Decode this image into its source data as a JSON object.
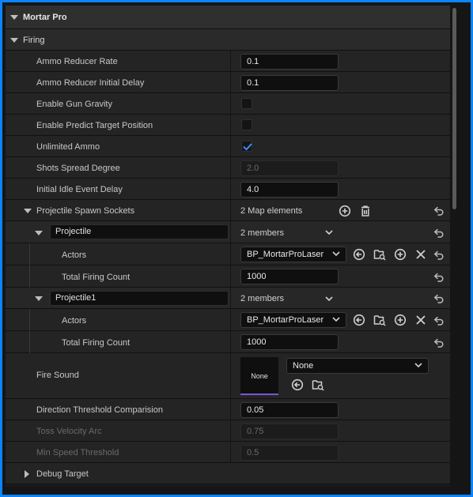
{
  "header": {
    "title": "Mortar Pro"
  },
  "firing": {
    "title": "Firing",
    "ammo_reducer_rate": {
      "label": "Ammo Reducer Rate",
      "value": "0.1"
    },
    "ammo_reducer_initial_delay": {
      "label": "Ammo Reducer Initial Delay",
      "value": "0.1"
    },
    "enable_gun_gravity": {
      "label": "Enable Gun Gravity",
      "checked": false
    },
    "enable_predict_target_position": {
      "label": "Enable Predict Target Position",
      "checked": false
    },
    "unlimited_ammo": {
      "label": "Unlimited Ammo",
      "checked": true
    },
    "shots_spread_degree": {
      "label": "Shots Spread Degree",
      "value": "2.0"
    },
    "initial_idle_event_delay": {
      "label": "Initial Idle Event Delay",
      "value": "4.0"
    },
    "projectile_spawn_sockets": {
      "label": "Projectile Spawn Sockets",
      "summary": "2 Map elements",
      "elements": [
        {
          "name": "Projectile",
          "summary": "2 members",
          "actors_label": "Actors",
          "actors_value": "BP_MortarProLaser",
          "count_label": "Total Firing Count",
          "count_value": "1000"
        },
        {
          "name": "Projectile1",
          "summary": "2 members",
          "actors_label": "Actors",
          "actors_value": "BP_MortarProLaser",
          "count_label": "Total Firing Count",
          "count_value": "1000"
        }
      ]
    },
    "fire_sound": {
      "label": "Fire Sound",
      "thumb": "None",
      "value": "None"
    },
    "direction_threshold_comparision": {
      "label": "Direction Threshold Comparision",
      "value": "0.05"
    },
    "toss_velocity_arc": {
      "label": "Toss Velocity Arc",
      "value": "0.75"
    },
    "min_speed_threshold": {
      "label": "Min Speed Threshold",
      "value": "0.5"
    }
  },
  "debug_target": {
    "title": "Debug Target"
  },
  "colors": {
    "accent": "#0a84ff",
    "checkbox_check": "#3b8cff",
    "asset_underline": "#7a55d6"
  }
}
